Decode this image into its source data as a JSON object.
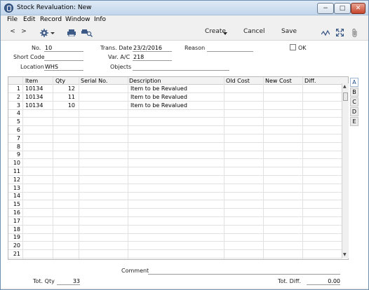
{
  "window": {
    "title": "Stock Revaluation: New",
    "min_label": "−",
    "max_label": "□",
    "close_label": "✕"
  },
  "menu": [
    "File",
    "Edit",
    "Record",
    "Window",
    "Info"
  ],
  "toolbar": {
    "prev": "<",
    "next": ">",
    "create": "Create",
    "cancel": "Cancel",
    "save": "Save"
  },
  "header": {
    "no_label": "No.",
    "no_value": "10",
    "trans_date_label": "Trans. Date",
    "trans_date_value": "23/2/2016",
    "reason_label": "Reason",
    "reason_value": "",
    "ok_label": "OK",
    "short_code_label": "Short Code",
    "short_code_value": "",
    "var_ac_label": "Var. A/C",
    "var_ac_value": "218",
    "location_label": "Location",
    "location_value": "WHS",
    "objects_label": "Objects",
    "objects_value": ""
  },
  "grid": {
    "columns": [
      "Item",
      "Qty",
      "Serial No.",
      "Description",
      "Old Cost",
      "New Cost",
      "Diff."
    ],
    "rows": [
      {
        "n": "1",
        "item": "10134",
        "qty": "12",
        "serial": "",
        "desc": "Item to be Revalued",
        "old": "",
        "new": "",
        "diff": ""
      },
      {
        "n": "2",
        "item": "10134",
        "qty": "11",
        "serial": "",
        "desc": "Item to be Revalued",
        "old": "",
        "new": "",
        "diff": ""
      },
      {
        "n": "3",
        "item": "10134",
        "qty": "10",
        "serial": "",
        "desc": "Item to be Revalued",
        "old": "",
        "new": "",
        "diff": ""
      },
      {
        "n": "4"
      },
      {
        "n": "5"
      },
      {
        "n": "6"
      },
      {
        "n": "7"
      },
      {
        "n": "8"
      },
      {
        "n": "9"
      },
      {
        "n": "10"
      },
      {
        "n": "11"
      },
      {
        "n": "12"
      },
      {
        "n": "13"
      },
      {
        "n": "14"
      },
      {
        "n": "15"
      },
      {
        "n": "16"
      },
      {
        "n": "17"
      },
      {
        "n": "18"
      },
      {
        "n": "19"
      },
      {
        "n": "20"
      },
      {
        "n": "21"
      }
    ]
  },
  "tabs": [
    "A",
    "B",
    "C",
    "D",
    "E"
  ],
  "footer": {
    "comment_label": "Comment",
    "comment_value": "",
    "tot_qty_label": "Tot. Qty",
    "tot_qty_value": "33",
    "tot_diff_label": "Tot. Diff.",
    "tot_diff_value": "0.00"
  }
}
